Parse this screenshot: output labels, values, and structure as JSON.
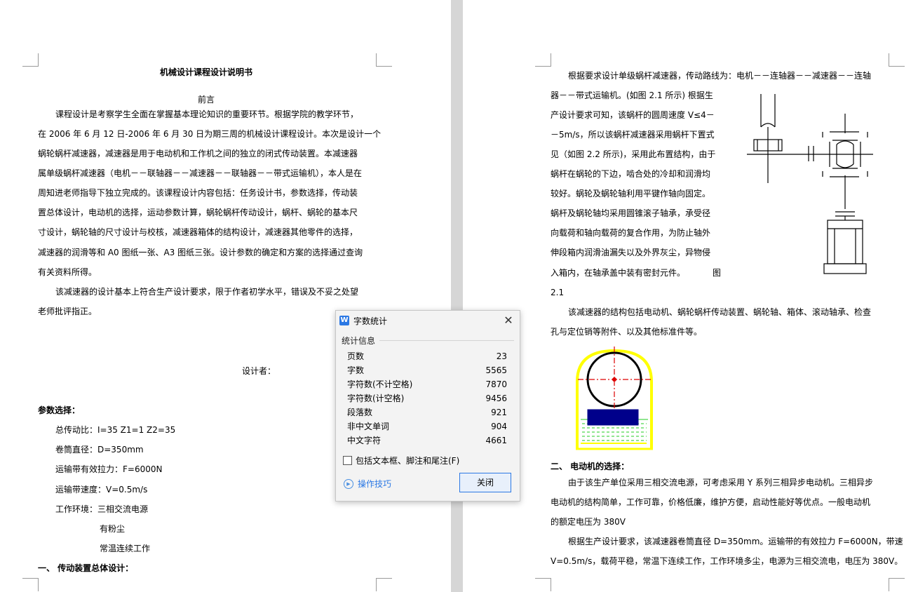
{
  "left_page": {
    "title": "机械设计课程设计说明书",
    "preface_heading": "前言",
    "preface_lines": [
      "课程设计是考察学生全面在掌握基本理论知识的重要环节。根据学院的教学环节，",
      "在 2006 年 6 月 12 日-2006 年 6 月 30 日为期三周的机械设计课程设计。本次是设计一个",
      "蜗轮蜗杆减速器，减速器是用于电动机和工作机之间的独立的闭式传动装置。本减速器",
      "属单级蜗杆减速器（电机－－联轴器－－减速器－－联轴器－－带式运输机），本人是在",
      "周知进老师指导下独立完成的。该课程设计内容包括：任务设计书，参数选择，传动装",
      "置总体设计，电动机的选择，运动参数计算，蜗轮蜗杆传动设计，蜗杆、蜗轮的基本尺",
      "寸设计，蜗轮轴的尺寸设计与校核，减速器箱体的结构设计，减速器其他零件的选择，",
      "减速器的润滑等和 A0 图纸一张、A3 图纸三张。设计参数的确定和方案的选择通过查询",
      "有关资料所得。"
    ],
    "preface_p2": [
      "该减速器的设计基本上符合生产设计要求，限于作者初学水平，错误及不妥之处望",
      "老师批评指正。"
    ],
    "designer_label": "设计者：",
    "params_heading": "参数选择：",
    "params": [
      "总传动比：I=35  Z1=1  Z2=35",
      "卷筒直径：D=350mm",
      "运输带有效拉力：F=6000N",
      "运输带速度：V=0.5m/s",
      "工作环境：三相交流电源"
    ],
    "env_extra": [
      "有粉尘",
      "常温连续工作"
    ],
    "section1_heading": "一、 传动装置总体设计："
  },
  "right_page": {
    "intro_line1": "根据要求设计单级蜗杆减速器，传动路线为：电机－－连轴器－－减速器－－连轴",
    "intro_lines": [
      "器－－带式运输机。(如图 2.1 所示) 根据生",
      "产设计要求可知，该蜗杆的圆周速度 V≤4－",
      "－5m/s，所以该蜗杆减速器采用蜗杆下置式",
      "见（如图 2.2 所示)，采用此布置结构，由于",
      "蜗杆在蜗轮的下边，啮合处的冷却和润滑均",
      "较好。蜗轮及蜗轮轴利用平键作轴向固定。",
      "蜗杆及蜗轮轴均采用圆锥滚子轴承，承受径",
      "向载荷和轴向载荷的复合作用，为防止轴外",
      "伸段箱内润滑油漏失以及外界灰尘，异物侵",
      "入箱内，在轴承盖中装有密封元件。"
    ],
    "fig_label_a": "图",
    "fig_label_b": "2.1",
    "structure_lines": [
      "该减速器的结构包括电动机、蜗轮蜗杆传动装置、蜗轮轴、箱体、滚动轴承、检查",
      "孔与定位销等附件、以及其他标准件等。"
    ],
    "section2_heading": "二、 电动机的选择：",
    "motor_lines": [
      "由于该生产单位采用三相交流电源，可考虑采用 Y 系列三相异步电动机。三相异步",
      "电动机的结构简单，工作可靠，价格低廉，维护方便，启动性能好等优点。一般电动机",
      "的额定电压为 380V"
    ],
    "req_lines": [
      "根据生产设计要求，该减速器卷筒直径 D=350mm。运输带的有效拉力 F=6000N，带速",
      "V=0.5m/s，载荷平稳，常温下连续工作，工作环境多尘，电源为三相交流电，电压为 380V。"
    ]
  },
  "dialog": {
    "app_icon_text": "W",
    "title": "字数统计",
    "section": "统计信息",
    "stats": [
      {
        "label": "页数",
        "value": "23"
      },
      {
        "label": "字数",
        "value": "5565"
      },
      {
        "label": "字符数(不计空格)",
        "value": "7870"
      },
      {
        "label": "字符数(计空格)",
        "value": "9456"
      },
      {
        "label": "段落数",
        "value": "921"
      },
      {
        "label": "非中文单词",
        "value": "904"
      },
      {
        "label": "中文字符",
        "value": "4661"
      }
    ],
    "checkbox_label": "包括文本框、脚注和尾注(F)",
    "checkbox_checked": false,
    "tips_label": "操作技巧",
    "close_button": "关闭",
    "close_glyph": "✕",
    "accent_color": "#2b78e4"
  }
}
